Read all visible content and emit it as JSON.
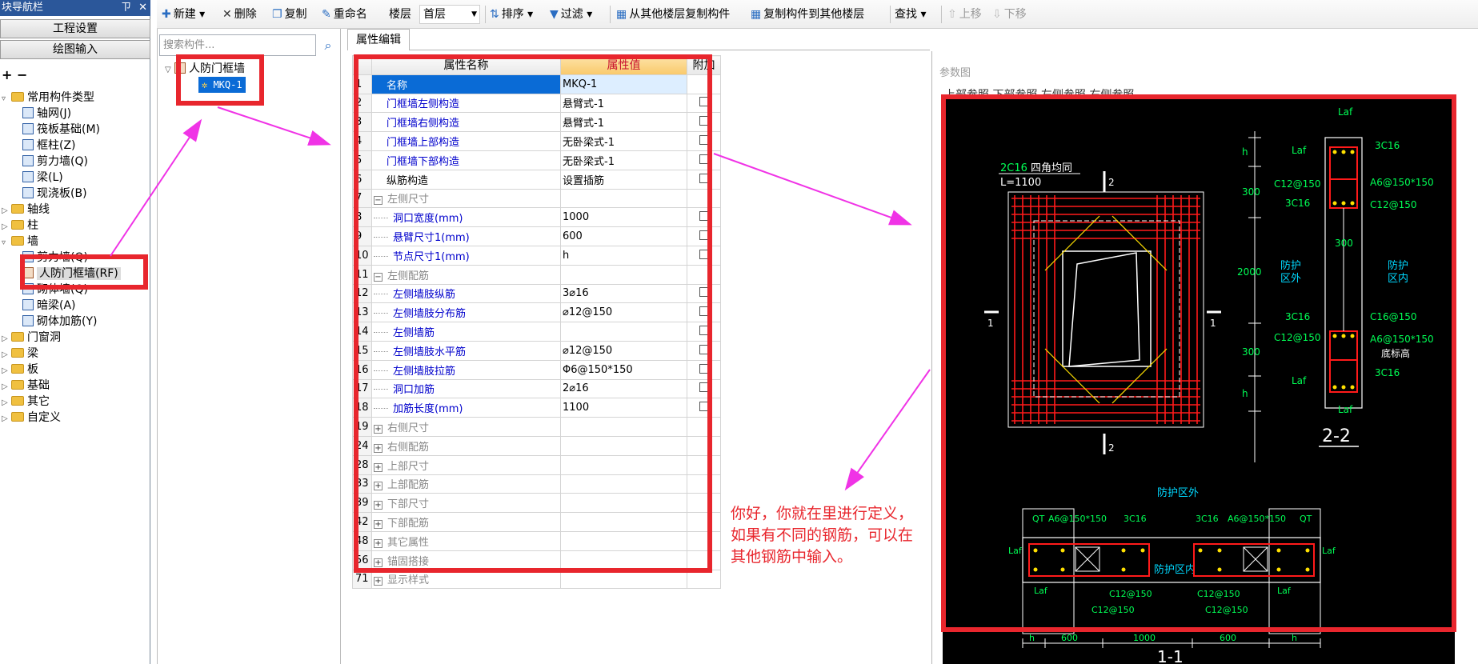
{
  "nav": {
    "title": "块导航栏",
    "pin": "ㄗ",
    "close": "✕",
    "buttons": [
      "工程设置",
      "绘图输入"
    ],
    "tools": "+ −",
    "tree": [
      {
        "label": "常用构件类型",
        "level": 0,
        "kind": "folder",
        "open": true
      },
      {
        "label": "轴网(J)",
        "level": 1,
        "kind": "comp"
      },
      {
        "label": "筏板基础(M)",
        "level": 1,
        "kind": "comp"
      },
      {
        "label": "框柱(Z)",
        "level": 1,
        "kind": "comp"
      },
      {
        "label": "剪力墙(Q)",
        "level": 1,
        "kind": "comp"
      },
      {
        "label": "梁(L)",
        "level": 1,
        "kind": "comp"
      },
      {
        "label": "现浇板(B)",
        "level": 1,
        "kind": "comp"
      },
      {
        "label": "轴线",
        "level": 0,
        "kind": "folder"
      },
      {
        "label": "柱",
        "level": 0,
        "kind": "folder"
      },
      {
        "label": "墙",
        "level": 0,
        "kind": "folder",
        "open": true
      },
      {
        "label": "剪力墙(Q)",
        "level": 1,
        "kind": "comp"
      },
      {
        "label": "人防门框墙(RF)",
        "level": 1,
        "kind": "comp",
        "selected": true
      },
      {
        "label": "砌体墙(Q)",
        "level": 1,
        "kind": "comp"
      },
      {
        "label": "暗梁(A)",
        "level": 1,
        "kind": "comp"
      },
      {
        "label": "砌体加筋(Y)",
        "level": 1,
        "kind": "comp"
      },
      {
        "label": "门窗洞",
        "level": 0,
        "kind": "folder"
      },
      {
        "label": "梁",
        "level": 0,
        "kind": "folder"
      },
      {
        "label": "板",
        "level": 0,
        "kind": "folder"
      },
      {
        "label": "基础",
        "level": 0,
        "kind": "folder"
      },
      {
        "label": "其它",
        "level": 0,
        "kind": "folder"
      },
      {
        "label": "自定义",
        "level": 0,
        "kind": "folder"
      }
    ]
  },
  "toolbar": {
    "items": [
      "新建",
      "删除",
      "复制",
      "重命名",
      "楼层",
      "首层",
      "排序",
      "过滤",
      "从其他楼层复制构件",
      "复制构件到其他楼层",
      "查找",
      "上移",
      "下移"
    ]
  },
  "component_panel": {
    "search_placeholder": "搜索构件...",
    "root": "人防门框墙",
    "child": "MKQ-1"
  },
  "property_editor": {
    "tab": "属性编辑",
    "headers": {
      "name": "属性名称",
      "value": "属性值",
      "extra": "附加"
    },
    "rows": [
      {
        "num": "1",
        "name": "名称",
        "value": "MKQ-1",
        "style": "plain",
        "selected": true,
        "cb": false
      },
      {
        "num": "2",
        "name": "门框墙左侧构造",
        "value": "悬臂式-1",
        "style": "link",
        "cb": true
      },
      {
        "num": "3",
        "name": "门框墙右侧构造",
        "value": "悬臂式-1",
        "style": "link",
        "cb": true
      },
      {
        "num": "4",
        "name": "门框墙上部构造",
        "value": "无卧梁式-1",
        "style": "link",
        "cb": true
      },
      {
        "num": "5",
        "name": "门框墙下部构造",
        "value": "无卧梁式-1",
        "style": "link",
        "cb": true
      },
      {
        "num": "6",
        "name": "纵筋构造",
        "value": "设置插筋",
        "style": "plain",
        "cb": true
      },
      {
        "num": "7",
        "name": "左侧尺寸",
        "value": "",
        "style": "grp",
        "pm": "−"
      },
      {
        "num": "8",
        "name": "洞口宽度(mm)",
        "value": "1000",
        "style": "sub",
        "cb": true
      },
      {
        "num": "9",
        "name": "悬臂尺寸1(mm)",
        "value": "600",
        "style": "sub",
        "cb": true
      },
      {
        "num": "10",
        "name": "节点尺寸1(mm)",
        "value": "h",
        "style": "sub",
        "cb": true
      },
      {
        "num": "11",
        "name": "左侧配筋",
        "value": "",
        "style": "grp",
        "pm": "−"
      },
      {
        "num": "12",
        "name": "左侧墙肢纵筋",
        "value": "3⌀16",
        "style": "sub",
        "cb": true
      },
      {
        "num": "13",
        "name": "左侧墙肢分布筋",
        "value": "⌀12@150",
        "style": "sub",
        "cb": true
      },
      {
        "num": "14",
        "name": "左侧墙筋",
        "value": "",
        "style": "sub",
        "cb": true
      },
      {
        "num": "15",
        "name": "左侧墙肢水平筋",
        "value": "⌀12@150",
        "style": "sub",
        "cb": true
      },
      {
        "num": "16",
        "name": "左侧墙肢拉筋",
        "value": "Φ6@150*150",
        "style": "sub",
        "cb": true
      },
      {
        "num": "17",
        "name": "洞口加筋",
        "value": "2⌀16",
        "style": "sub",
        "cb": true
      },
      {
        "num": "18",
        "name": "加筋长度(mm)",
        "value": "1100",
        "style": "sub",
        "cb": true
      },
      {
        "num": "19",
        "name": "右侧尺寸",
        "value": "",
        "style": "grp",
        "pm": "+"
      },
      {
        "num": "24",
        "name": "右侧配筋",
        "value": "",
        "style": "grp",
        "pm": "+"
      },
      {
        "num": "28",
        "name": "上部尺寸",
        "value": "",
        "style": "grp",
        "pm": "+"
      },
      {
        "num": "33",
        "name": "上部配筋",
        "value": "",
        "style": "grp",
        "pm": "+"
      },
      {
        "num": "39",
        "name": "下部尺寸",
        "value": "",
        "style": "grp",
        "pm": "+"
      },
      {
        "num": "42",
        "name": "下部配筋",
        "value": "",
        "style": "grp",
        "pm": "+"
      },
      {
        "num": "48",
        "name": "其它属性",
        "value": "",
        "style": "grp",
        "pm": "+"
      },
      {
        "num": "56",
        "name": "锚固搭接",
        "value": "",
        "style": "grp",
        "pm": "+"
      },
      {
        "num": "71",
        "name": "显示样式",
        "value": "",
        "style": "grp",
        "pm": "+"
      }
    ]
  },
  "param_panel": {
    "title": "参数图",
    "tabs": "上部参照   下部参照   左侧参照   右侧参照"
  },
  "diagram": {
    "sec22_title": "2-2",
    "sec11_title": "1-1",
    "lbl_2c16": "2C16",
    "lbl_corner": "四角均同",
    "lbl_l1100": "L=1100",
    "lbl_2": "2",
    "lbl_1": "1",
    "dim_h": "h",
    "dim_300": "300",
    "dim_2000": "2000",
    "lbl_laf": "Laf",
    "lbl_3c16": "3C16",
    "lbl_c12": "C12@150",
    "lbl_a6": "A6@150*150",
    "lbl_c16": "C16@150",
    "lbl_out": "防护\n区外",
    "lbl_in": "防护\n区内",
    "lbl_bottom": "底标高",
    "lbl_outzone": "防护区外",
    "lbl_inzone": "防护区内",
    "lbl_qt": "QT",
    "dim_600": "600",
    "dim_1000": "1000"
  },
  "annotation": {
    "lines": [
      "你好，你就在里进行定义，",
      "如果有不同的钢筋，可以在",
      "其他钢筋中输入。"
    ]
  },
  "colors": {
    "highlight_red": "#e8262d",
    "arrow_magenta": "#f033e6",
    "selection_blue": "#0a6bd6"
  }
}
